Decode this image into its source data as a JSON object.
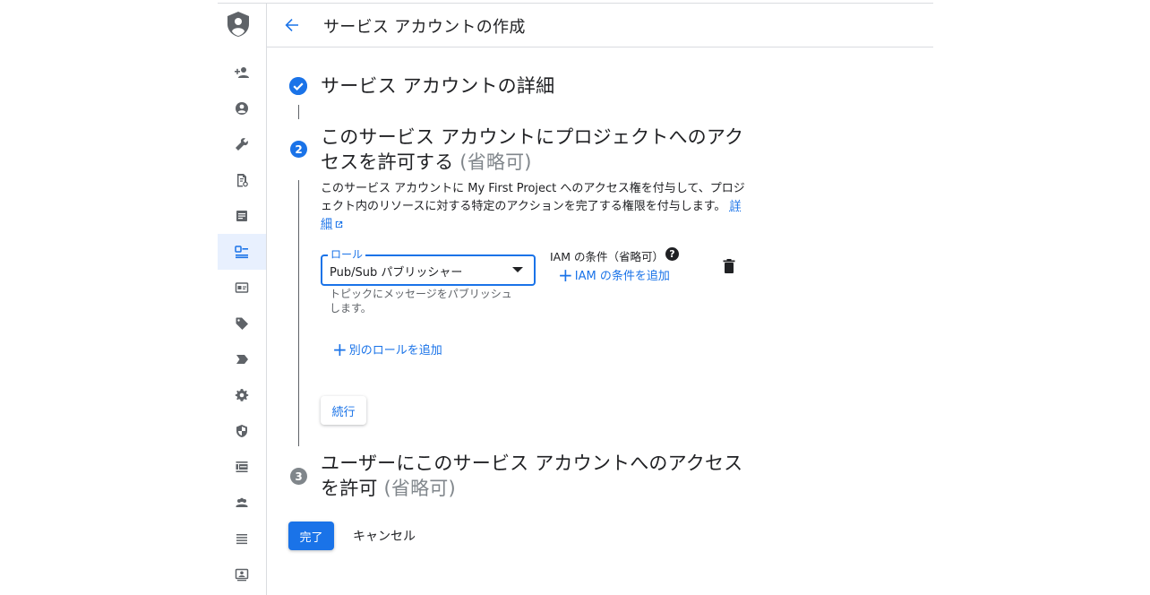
{
  "header": {
    "title": "サービス アカウントの作成"
  },
  "sidebar": {
    "items": [
      {
        "icon": "person-add-icon",
        "active": false
      },
      {
        "icon": "account-circle-icon",
        "active": false
      },
      {
        "icon": "wrench-icon",
        "active": false
      },
      {
        "icon": "policy-document-icon",
        "active": false
      },
      {
        "icon": "article-icon",
        "active": false
      },
      {
        "icon": "service-account-icon",
        "active": true
      },
      {
        "icon": "id-card-icon",
        "active": false
      },
      {
        "icon": "tag-icon",
        "active": false
      },
      {
        "icon": "label-icon",
        "active": false
      },
      {
        "icon": "settings-icon",
        "active": false
      },
      {
        "icon": "security-shield-icon",
        "active": false
      },
      {
        "icon": "view-list-icon",
        "active": false
      },
      {
        "icon": "group-icon",
        "active": false
      },
      {
        "icon": "list-icon",
        "active": false
      },
      {
        "icon": "contact-card-icon",
        "active": false
      }
    ]
  },
  "steps": {
    "step1": {
      "number": "✓",
      "title": "サービス アカウントの詳細"
    },
    "step2": {
      "number": "2",
      "title": "このサービス アカウントにプロジェクトへのアクセスを許可する",
      "optional": "(省略可)",
      "description": "このサービス アカウントに My First Project へのアクセス権を付与して、プロジェクト内のリソースに対する特定のアクションを完了する権限を付与します。",
      "learn_more": "詳細",
      "role_label": "ロール",
      "role_value": "Pub/Sub パブリッシャー",
      "role_hint": "トピックにメッセージをパブリッシュします。",
      "iam_condition_label": "IAM の条件（省略可）",
      "add_iam_condition": "IAM の条件を追加",
      "add_role": "別のロールを追加",
      "continue": "続行"
    },
    "step3": {
      "number": "3",
      "title": "ユーザーにこのサービス アカウントへのアクセスを許可",
      "optional": "(省略可)"
    }
  },
  "footer": {
    "done": "完了",
    "cancel": "キャンセル"
  },
  "colors": {
    "accent": "#1a73e8",
    "text": "#202124",
    "muted": "#80868b",
    "active_bg": "#e8f0fe"
  }
}
